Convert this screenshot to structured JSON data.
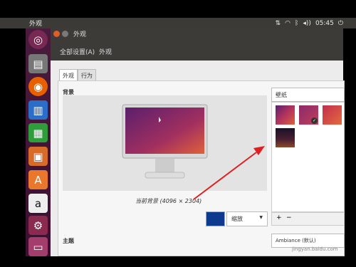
{
  "topbar": {
    "app_title": "外观",
    "time": "05:45",
    "tray_icons": [
      "network-icon",
      "wifi-icon",
      "bluetooth-icon",
      "volume-icon",
      "power-icon"
    ]
  },
  "window": {
    "title": "外观",
    "nav_back": "全部设置(A)",
    "nav_current": "外观",
    "tabs": [
      "外观",
      "行为"
    ]
  },
  "background": {
    "label": "背景",
    "caption": "当前背景 (4096 × 2304)",
    "color": "#0d3a8c",
    "mode": "缩放",
    "wallpaper_source": "壁纸",
    "wallpapers": [
      "wallpaper-1",
      "wallpaper-2",
      "wallpaper-3",
      "wallpaper-4"
    ],
    "selected": 1,
    "add": "+",
    "remove": "−"
  },
  "theme": {
    "label": "主题",
    "value": "Ambiance (默认)"
  },
  "watermark": "jingyan.baidu.com"
}
